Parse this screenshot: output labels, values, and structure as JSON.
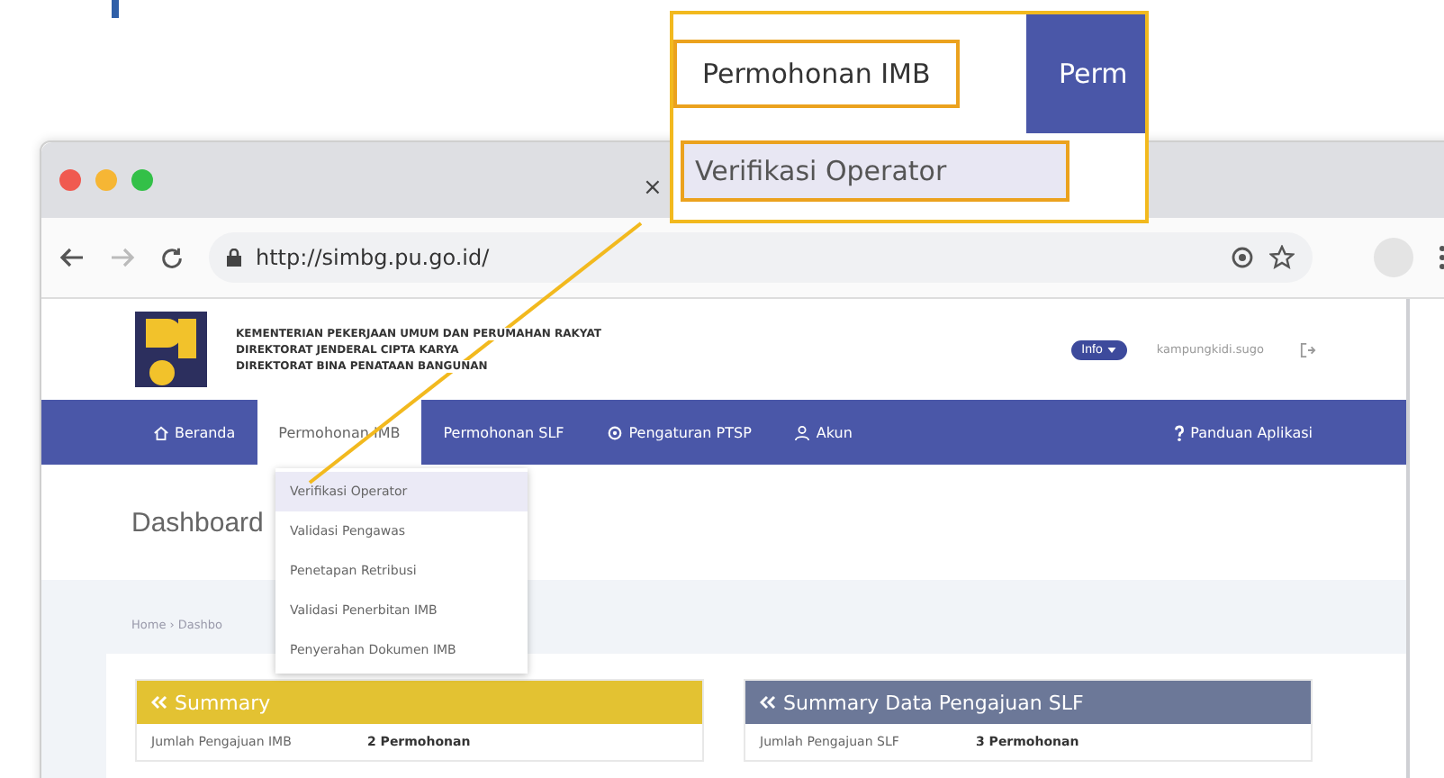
{
  "browser": {
    "tab_close": "×",
    "url": "http://simbg.pu.go.id/"
  },
  "header": {
    "lines": [
      "KEMENTERIAN PEKERJAAN UMUM DAN PERUMAHAN RAKYAT",
      "DIREKTORAT JENDERAL CIPTA KARYA",
      "DIREKTORAT BINA PENATAAN BANGUNAN"
    ],
    "info_button": "Info",
    "user": "kampungkidi.sugo"
  },
  "nav": [
    {
      "label": "Beranda",
      "selected": false
    },
    {
      "label": "Permohonan IMB",
      "selected": true
    },
    {
      "label": "Permohonan SLF",
      "selected": false
    },
    {
      "label": "Pengaturan PTSP",
      "selected": false
    },
    {
      "label": "Akun",
      "selected": false
    },
    {
      "label": "Panduan Aplikasi",
      "selected": false
    }
  ],
  "dropdown": [
    {
      "label": "Verifikasi Operator",
      "selected": true
    },
    {
      "label": "Validasi Pengawas",
      "selected": false
    },
    {
      "label": "Penetapan Retribusi",
      "selected": false
    },
    {
      "label": "Validasi Penerbitan IMB",
      "selected": false
    },
    {
      "label": "Penyerahan Dokumen IMB",
      "selected": false
    }
  ],
  "page_title": "Dashboard",
  "breadcrumb": "Home › Dashbo",
  "cards": [
    {
      "title": "Summary",
      "color": "#e3c232",
      "rows": [
        {
          "label": "Jumlah Pengajuan IMB",
          "value": "2 Permohonan"
        }
      ]
    },
    {
      "title": "Summary Data Pengajuan SLF",
      "color": "#6c7898",
      "rows": [
        {
          "label": "Jumlah Pengajuan SLF",
          "value": "3 Permohonan"
        }
      ]
    }
  ],
  "callout": {
    "tabs": [
      {
        "label": "Permohonan IMB",
        "selected": true
      },
      {
        "label": "Perm",
        "selected": false
      }
    ],
    "item": "Verifikasi Operator"
  }
}
